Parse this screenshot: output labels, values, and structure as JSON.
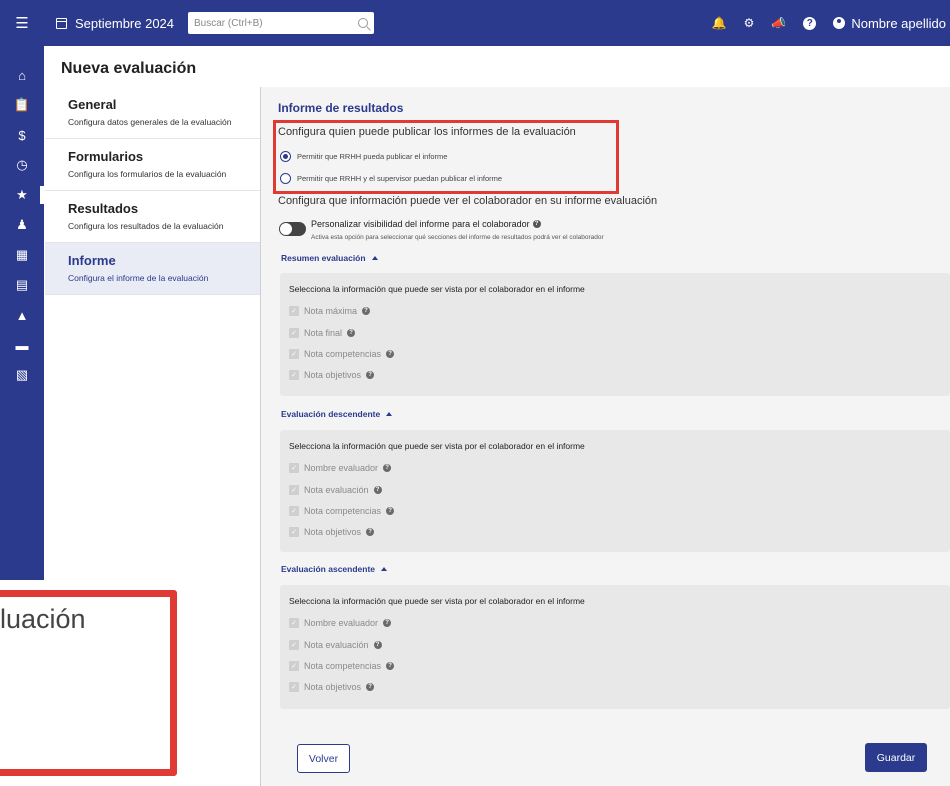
{
  "topbar": {
    "menu_icon": "hamburger-icon",
    "date_label": "Septiembre 2024",
    "search_placeholder": "Buscar (Ctrl+B)",
    "user_name": "Nombre apellido"
  },
  "page": {
    "title": "Nueva evaluación"
  },
  "nav": {
    "items": [
      {
        "title": "General",
        "subtitle": "Configura datos generales de la evaluación"
      },
      {
        "title": "Formularios",
        "subtitle": "Configura los formularios de la evaluación"
      },
      {
        "title": "Resultados",
        "subtitle": "Configura los resultados de la evaluación"
      },
      {
        "title": "Informe",
        "subtitle": "Configura el informe de la evaluación",
        "selected": true
      }
    ]
  },
  "main": {
    "section_title": "Informe de resultados",
    "publish_question": "Configura quien puede publicar los informes de la evaluación",
    "publish_options": [
      {
        "label": "Permitir que RRHH pueda publicar el informe",
        "checked": true
      },
      {
        "label": "Permitir que RRHH y el supervisor puedan publicar el informe",
        "checked": false
      }
    ],
    "visibility_question": "Configura que información puede ver el colaborador en su informe evaluación",
    "toggle_label": "Personalizar visibilidad del informe para el colaborador",
    "toggle_sub": "Activa esta opción para seleccionar qué secciones del informe de resultados podrá ver el colaborador",
    "toggle_on": false,
    "groups": [
      {
        "title": "Resumen evaluación",
        "intro": "Selecciona la información que puede ser vista por el colaborador en el informe",
        "options": [
          "Nota máxima",
          "Nota final",
          "Nota competencias",
          "Nota objetivos"
        ]
      },
      {
        "title": "Evaluación descendente",
        "intro": "Selecciona la información que puede ser vista por el colaborador en el informe",
        "options": [
          "Nombre evaluador",
          "Nota evaluación",
          "Nota competencias",
          "Nota objetivos"
        ]
      },
      {
        "title": "Evaluación ascendente",
        "intro": "Selecciona la información que puede ser vista por el colaborador en el informe",
        "options": [
          "Nombre evaluador",
          "Nota evaluación",
          "Nota competencias",
          "Nota objetivos"
        ]
      }
    ],
    "back_label": "Volver",
    "save_label": "Guardar"
  },
  "inset": {
    "text": "luación"
  },
  "colors": {
    "brand": "#2b3a8c",
    "highlight": "#e03a35"
  }
}
